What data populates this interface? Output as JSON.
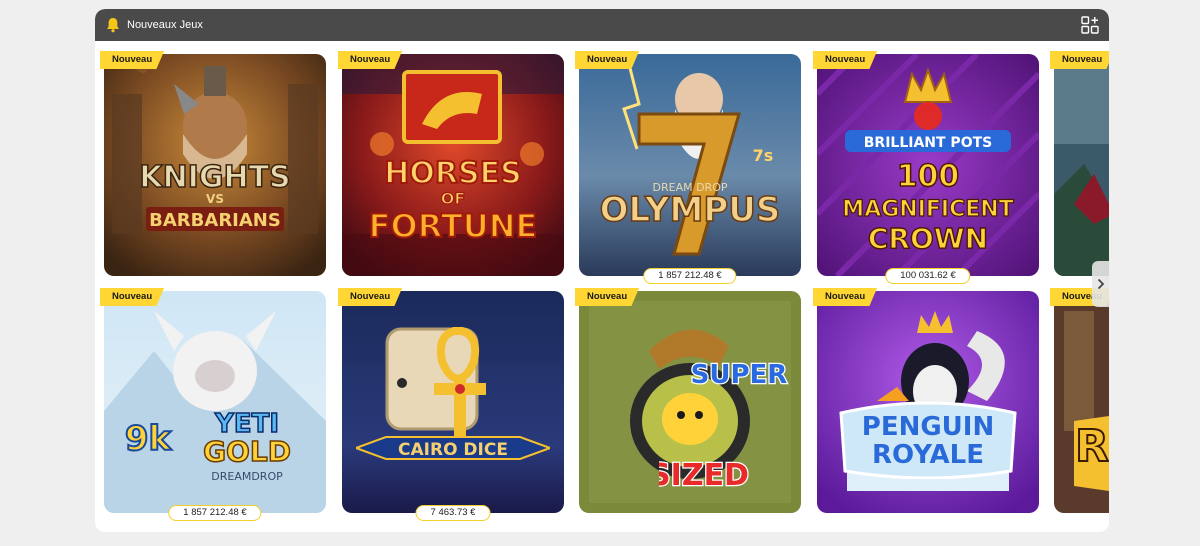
{
  "header": {
    "title": "Nouveaux Jeux",
    "bell_icon": "bell-icon",
    "grid_icon": "grid-add-icon"
  },
  "games": [
    {
      "title_lines": [
        "KNIGHTS",
        "VS",
        "BARBARIANS"
      ],
      "badge": "Nouveau",
      "jackpot": null
    },
    {
      "title_lines": [
        "HORSES",
        "OF",
        "FORTUNE"
      ],
      "badge": "Nouveau",
      "jackpot": null
    },
    {
      "title_lines": [
        "7s",
        "DREAM DROP",
        "OLYMPUS"
      ],
      "badge": "Nouveau",
      "jackpot": "1 857 212.48 €"
    },
    {
      "title_lines": [
        "BRILLIANT POTS",
        "100",
        "MAGNIFICENT",
        "CROWN"
      ],
      "badge": "Nouveau",
      "jackpot": "100 031.62 €"
    },
    {
      "title_lines": [],
      "badge": "Nouveau",
      "jackpot": null
    },
    {
      "title_lines": [
        "9k",
        "YETI",
        "GOLD",
        "DREAMDROP"
      ],
      "badge": "Nouveau",
      "jackpot": "1 857 212.48 €"
    },
    {
      "title_lines": [
        "CAIRO DICE"
      ],
      "badge": "Nouveau",
      "jackpot": "7 463.73 €"
    },
    {
      "title_lines": [
        "SUPER",
        "SIZED"
      ],
      "badge": "Nouveau",
      "jackpot": null
    },
    {
      "title_lines": [
        "PENGUIN",
        "ROYALE"
      ],
      "badge": "Nouveau",
      "jackpot": null
    },
    {
      "title_lines": [
        "R"
      ],
      "badge": "Nouveau",
      "jackpot": null
    }
  ],
  "colors": {
    "header_bg": "#4a4a4a",
    "badge_bg": "#ffd633",
    "jackpot_border": "#f2d02a"
  }
}
